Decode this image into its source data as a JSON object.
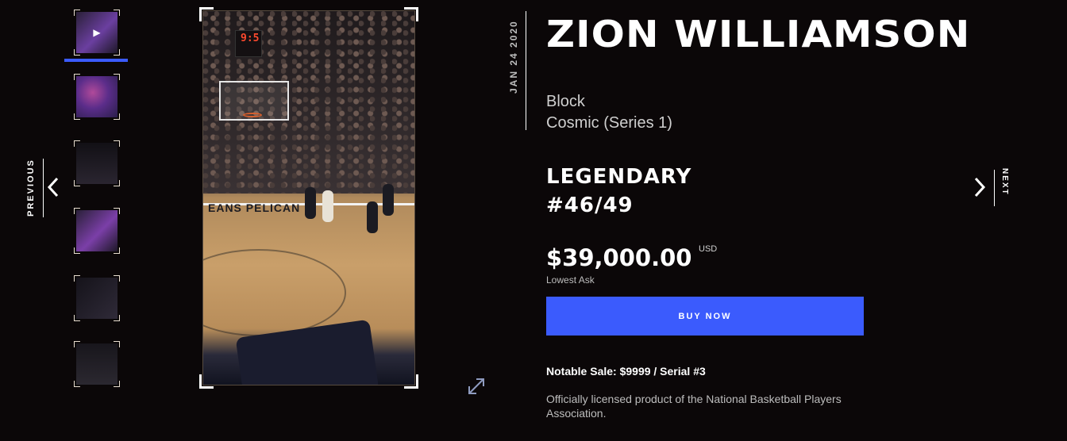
{
  "moment": {
    "date": "JAN 24 2020",
    "player_name": "ZION WILLIAMSON",
    "play_type": "Block",
    "set": "Cosmic (Series 1)",
    "tier": "LEGENDARY",
    "serial": "#46/49"
  },
  "pricing": {
    "price": "$39,000.00",
    "currency": "USD",
    "price_caption": "Lowest Ask",
    "buy_label": "BUY NOW"
  },
  "notable_sale": "Notable Sale: $9999 / Serial #3",
  "license_text": "Officially licensed product of the National Basketball Players Association.",
  "nav": {
    "previous_label": "PREVIOUS",
    "next_label": "NEXT"
  },
  "video": {
    "shot_clock": "9:5",
    "court_text": "EANS PELICAN"
  },
  "thumbnails": [
    {
      "name": "thumbnail-video",
      "icon": "play-icon"
    },
    {
      "name": "thumbnail-stats"
    },
    {
      "name": "thumbnail-block-card"
    },
    {
      "name": "thumbnail-player-card"
    },
    {
      "name": "thumbnail-action-card"
    },
    {
      "name": "thumbnail-team-logo"
    }
  ],
  "colors": {
    "background": "#0b0708",
    "accent": "#3b5bfd",
    "text": "#ffffff",
    "muted": "#bdbdbd"
  }
}
